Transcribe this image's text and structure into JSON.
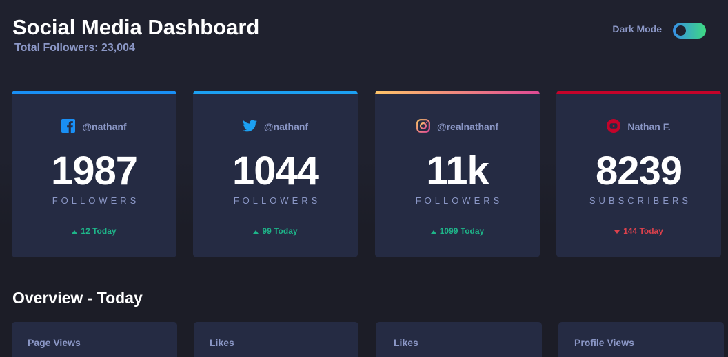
{
  "header": {
    "title": "Social Media Dashboard",
    "total_followers": "Total Followers: 23,004"
  },
  "mode": {
    "label": "Dark Mode",
    "enabled": true
  },
  "cards": [
    {
      "platform": "facebook",
      "icon": "facebook-icon",
      "handle": "@nathanf",
      "count": "1987",
      "unit": "FOLLOWERS",
      "change": "12 Today",
      "trend": "up",
      "color": "#198ff5"
    },
    {
      "platform": "twitter",
      "icon": "twitter-icon",
      "handle": "@nathanf",
      "count": "1044",
      "unit": "FOLLOWERS",
      "change": "99 Today",
      "trend": "up",
      "color": "#1ca0f2"
    },
    {
      "platform": "instagram",
      "icon": "instagram-icon",
      "handle": "@realnathanf",
      "count": "11k",
      "unit": "FOLLOWERS",
      "change": "1099 Today",
      "trend": "up",
      "color": "#df4996"
    },
    {
      "platform": "youtube",
      "icon": "youtube-icon",
      "handle": "Nathan F.",
      "count": "8239",
      "unit": "SUBSCRIBERS",
      "change": "144 Today",
      "trend": "down",
      "color": "#c4032a"
    }
  ],
  "overview": {
    "title": "Overview - Today",
    "items": [
      {
        "label": "Page Views"
      },
      {
        "label": "Likes"
      },
      {
        "label": "Likes"
      },
      {
        "label": "Profile Views"
      }
    ]
  },
  "colors": {
    "background": "#1f212e",
    "card": "#252b43",
    "muted_text": "#8b97c6",
    "up": "#1eb589",
    "down": "#dc414c",
    "toggle_start": "#378fe6",
    "toggle_end": "#3eda82"
  }
}
